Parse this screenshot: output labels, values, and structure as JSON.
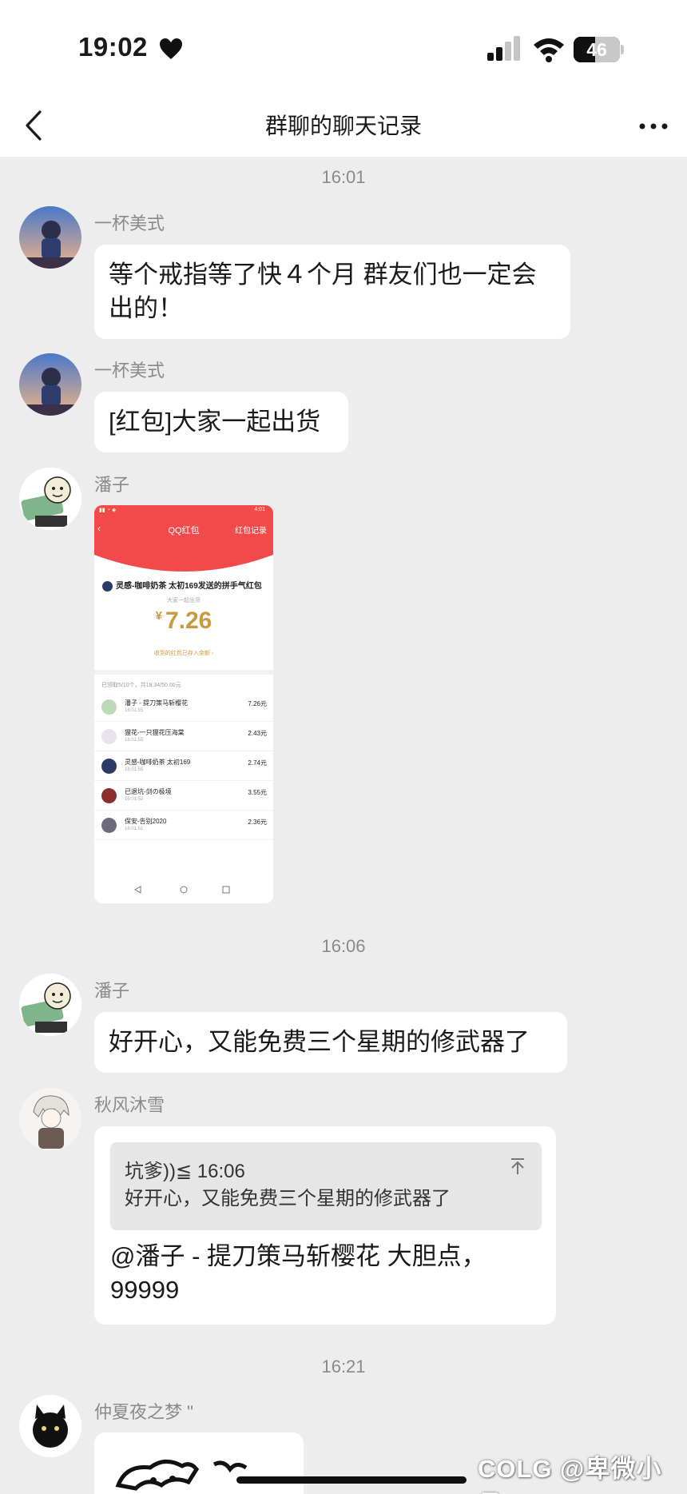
{
  "status_bar": {
    "time": "19:02",
    "battery": "46",
    "battery_level_percent": 46
  },
  "nav": {
    "title": "群聊的聊天记录"
  },
  "messages": [
    {
      "timestamp": "16:01"
    },
    {
      "sender": "一杯美式",
      "text": "等个戒指等了快４个月 群友们也一定会出的！"
    },
    {
      "sender": "一杯美式",
      "text": "[红包]大家一起出货"
    },
    {
      "sender": "潘子"
    },
    {
      "timestamp": "16:06"
    },
    {
      "sender": "潘子",
      "text": "好开心，又能免费三个星期的修武器了"
    },
    {
      "sender": "秋风沐雪"
    },
    {
      "timestamp": "16:21"
    },
    {
      "sender": "仲夏夜之梦 \""
    }
  ],
  "red_packet": {
    "header_title": "QQ红包",
    "header_link": "红包记录",
    "status_time": "4:01",
    "sender_line": "灵感-咖啡奶茶 太初169发送的拼手气红包",
    "greeting": "大家一起出货",
    "currency": "¥",
    "amount": "7.26",
    "saved_note": "收到的红包已存入余额 ›",
    "summary": "已领取5/10个，共18.34/50.00元",
    "rows": [
      {
        "name": "潘子 - 提刀策马斩樱花",
        "time": "16:01:55",
        "amount": "7.26元"
      },
      {
        "name": "狸花-一只狸花压海棠",
        "time": "16:01:55",
        "amount": "2.43元"
      },
      {
        "name": "灵感-咖啡奶茶 太初169",
        "time": "16:01:55",
        "amount": "2.74元"
      },
      {
        "name": "已退坑-剑の极境",
        "time": "16:01:52",
        "amount": "3.55元"
      },
      {
        "name": "保安-告别2020",
        "time": "16:01:51",
        "amount": "2.36元"
      }
    ]
  },
  "quote": {
    "head": "坑爹))≦ 16:06",
    "text": "好开心，又能免费三个星期的修武器了",
    "reply": "@潘子 - 提刀策马斩樱花 大胆点，99999"
  },
  "watermark": "COLG @卑微小承",
  "colors": {
    "background": "#ededed",
    "red_packet_red": "#f24a4a",
    "amount_gold": "#c99a3d"
  }
}
